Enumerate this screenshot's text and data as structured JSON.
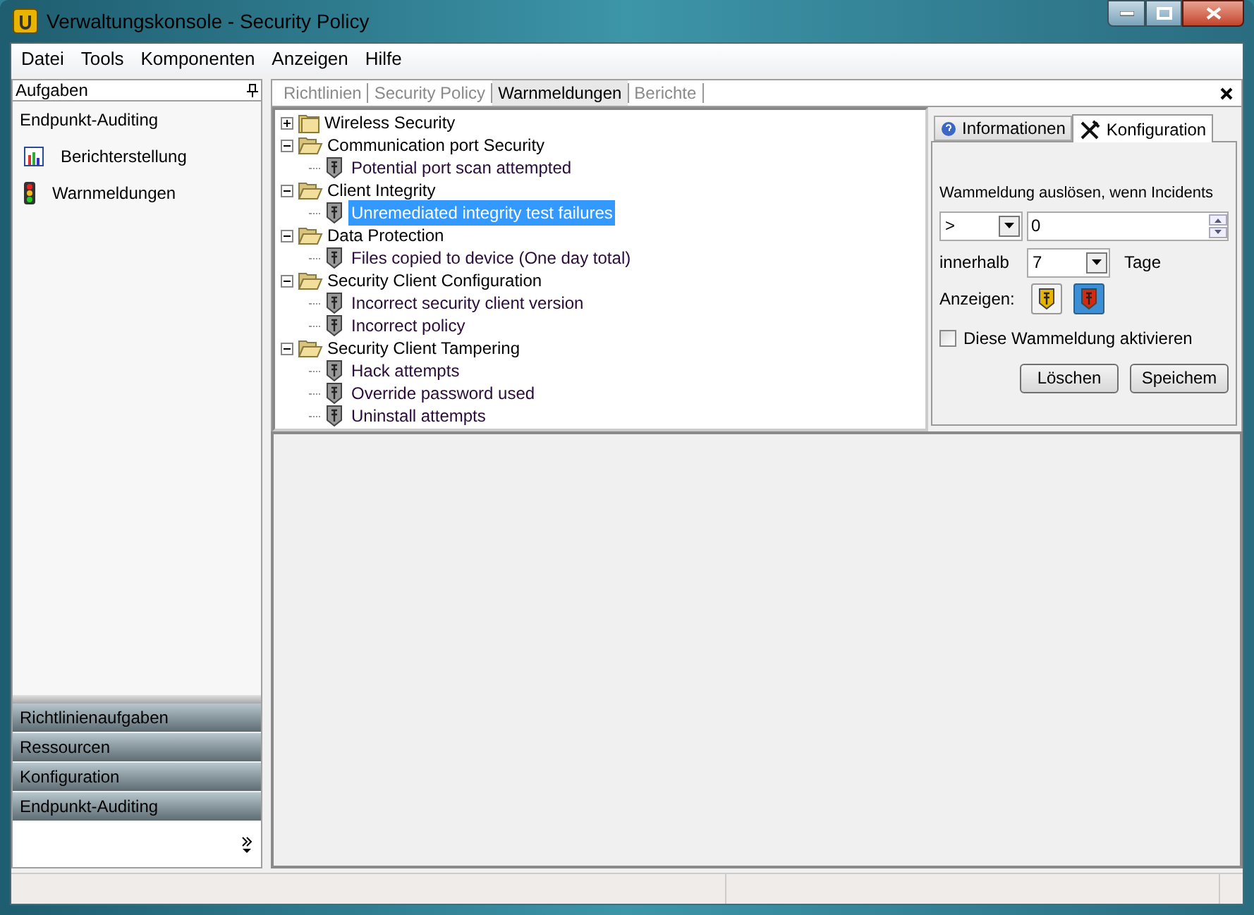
{
  "window": {
    "title": "Verwaltungskonsole - Security Policy"
  },
  "menu": [
    "Datei",
    "Tools",
    "Komponenten",
    "Anzeigen",
    "Hilfe"
  ],
  "tasks_panel": {
    "title": "Aufgaben",
    "section": "Endpunkt-Auditing",
    "items": [
      {
        "label": "Berichterstellung"
      },
      {
        "label": "Warnmeldungen"
      }
    ]
  },
  "nav_buttons": [
    "Richtlinienaufgaben",
    "Ressourcen",
    "Konfiguration",
    "Endpunkt-Auditing"
  ],
  "doc_tabs": [
    {
      "label": "Richtlinien",
      "selected": false
    },
    {
      "label": "Security Policy",
      "selected": false
    },
    {
      "label": "Warnmeldungen",
      "selected": true
    },
    {
      "label": "Berichte",
      "selected": false
    }
  ],
  "tree": [
    {
      "label": "Wireless Security",
      "expanded": false
    },
    {
      "label": "Communication port Security",
      "expanded": true,
      "children": [
        {
          "label": "Potential port scan attempted",
          "selected": false
        }
      ]
    },
    {
      "label": "Client Integrity",
      "expanded": true,
      "children": [
        {
          "label": "Unremediated integrity test failures",
          "selected": true
        }
      ]
    },
    {
      "label": "Data Protection",
      "expanded": true,
      "children": [
        {
          "label": "Files copied to device (One day total)",
          "selected": false
        }
      ]
    },
    {
      "label": "Security Client Configuration",
      "expanded": true,
      "children": [
        {
          "label": "Incorrect security client version",
          "selected": false
        },
        {
          "label": "Incorrect policy",
          "selected": false
        }
      ]
    },
    {
      "label": "Security Client Tampering",
      "expanded": true,
      "children": [
        {
          "label": "Hack attempts",
          "selected": false
        },
        {
          "label": "Override password used",
          "selected": false
        },
        {
          "label": "Uninstall attempts",
          "selected": false
        }
      ]
    }
  ],
  "side_tabs": [
    {
      "label": "Informationen",
      "selected": false
    },
    {
      "label": "Konfiguration",
      "selected": true
    }
  ],
  "config": {
    "trigger_label": "Wammeldung auslösen, wenn Incidents",
    "operator": ">",
    "count": "0",
    "within_label": "innerhalb",
    "days": "7",
    "days_unit": "Tage",
    "display_label": "Anzeigen:",
    "severity": [
      {
        "color": "#e8b400",
        "selected": false
      },
      {
        "color": "#d42a10",
        "selected": true
      }
    ],
    "enable": {
      "label": "Diese Wammeldung aktivieren",
      "checked": false
    },
    "buttons": [
      "Löschen",
      "Speichem"
    ]
  }
}
